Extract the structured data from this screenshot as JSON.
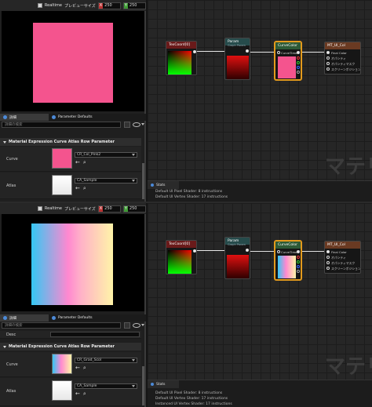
{
  "top": {
    "toolbar": {
      "realtime": "Realtime",
      "preview_size": "プレビューサイズ",
      "x_label": "X",
      "x_value": "250",
      "y_label": "Y",
      "y_value": "250"
    },
    "tabs": [
      {
        "label": "詳細"
      },
      {
        "label": "Parameter Defaults"
      }
    ],
    "search": {
      "placeholder": "詳細の検索"
    },
    "category": "Material Expression Curve Atlas Row Parameter",
    "curve": {
      "label": "Curve",
      "value": "CR_Col_Pink2"
    },
    "atlas": {
      "label": "Atlas",
      "value": "CA_Sample"
    },
    "stats": {
      "tab": "Stats",
      "lines": [
        "Default UI Pixel Shader: 8 instructions",
        "Default UI Vertex Shader: 17 instructions"
      ]
    }
  },
  "bottom": {
    "toolbar": {
      "realtime": "Realtime",
      "preview_size": "プレビューサイズ",
      "x_label": "X",
      "x_value": "250",
      "y_label": "Y",
      "y_value": "250"
    },
    "tabs": [
      {
        "label": "詳細"
      },
      {
        "label": "Parameter Defaults"
      }
    ],
    "search": {
      "placeholder": "詳細の検索"
    },
    "desc": {
      "label": "Desc"
    },
    "category": "Material Expression Curve Atlas Row Parameter",
    "curve": {
      "label": "Curve",
      "value": "CR_Grad_Scol"
    },
    "atlas": {
      "label": "Atlas",
      "value": "CA_Sample"
    },
    "stats": {
      "tab": "Stats",
      "lines": [
        "Default UI Pixel Shader: 8 instructions",
        "Default UI Vertex Shader: 17 instructions",
        "Instanced UI Vertex Shader: 17 instructions"
      ]
    }
  },
  "graph": {
    "watermark": "マテリ",
    "texcoord": {
      "title": "TexCoord[0]"
    },
    "param": {
      "title": "Param",
      "subtitle": "Graph Param"
    },
    "curve_node": {
      "title": "CurveColor",
      "input": "CurveTime"
    },
    "output": {
      "top_title": "MT_UI_Col",
      "bottom_title": "MT_UI_Col",
      "pins": [
        "Final Color",
        "オパシティ",
        "オパシティマスク",
        "スクリーンポジション"
      ]
    }
  },
  "colors": {
    "pink": "#f4548e",
    "node_header_green": "#3b5a3c",
    "node_header_red": "#6a1a1a",
    "selection": "#e39a1c"
  }
}
